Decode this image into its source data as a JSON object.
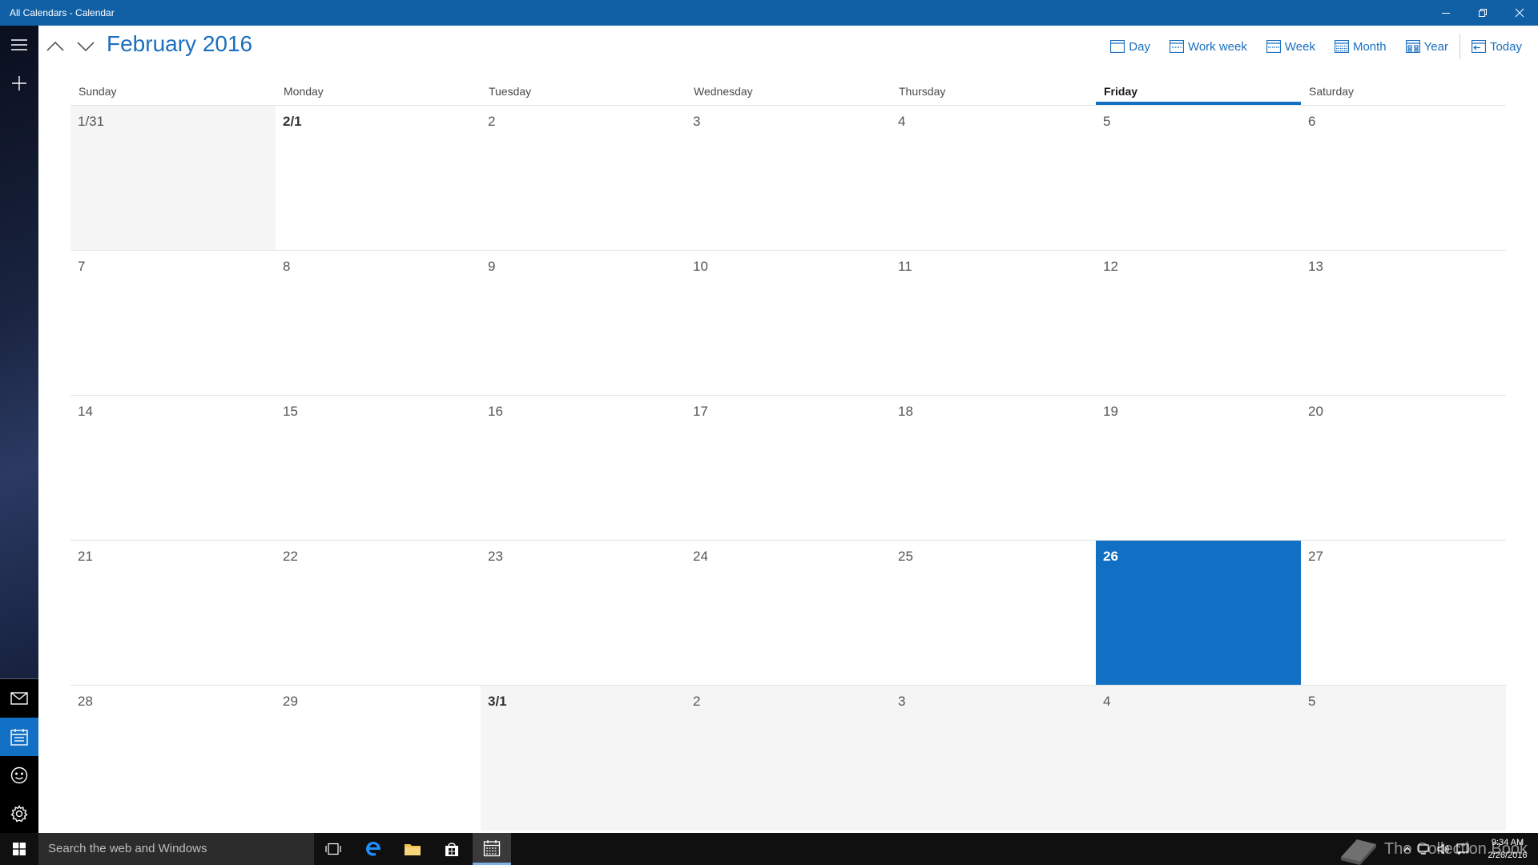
{
  "window": {
    "title": "All Calendars - Calendar"
  },
  "header": {
    "month_title": "February 2016",
    "views": [
      {
        "label": "Day",
        "icon": "day-view-icon"
      },
      {
        "label": "Work week",
        "icon": "work-week-view-icon"
      },
      {
        "label": "Week",
        "icon": "week-view-icon"
      },
      {
        "label": "Month",
        "icon": "month-view-icon"
      },
      {
        "label": "Year",
        "icon": "year-view-icon"
      },
      {
        "label": "Today",
        "icon": "today-icon"
      }
    ]
  },
  "calendar": {
    "weekdays": [
      "Sunday",
      "Monday",
      "Tuesday",
      "Wednesday",
      "Thursday",
      "Friday",
      "Saturday"
    ],
    "today_weekday_index": 5,
    "weeks": [
      [
        {
          "label": "1/31",
          "other": true
        },
        {
          "label": "2/1",
          "first": true
        },
        {
          "label": "2"
        },
        {
          "label": "3"
        },
        {
          "label": "4"
        },
        {
          "label": "5"
        },
        {
          "label": "6"
        }
      ],
      [
        {
          "label": "7"
        },
        {
          "label": "8"
        },
        {
          "label": "9"
        },
        {
          "label": "10"
        },
        {
          "label": "11"
        },
        {
          "label": "12"
        },
        {
          "label": "13"
        }
      ],
      [
        {
          "label": "14"
        },
        {
          "label": "15"
        },
        {
          "label": "16"
        },
        {
          "label": "17"
        },
        {
          "label": "18"
        },
        {
          "label": "19"
        },
        {
          "label": "20"
        }
      ],
      [
        {
          "label": "21"
        },
        {
          "label": "22"
        },
        {
          "label": "23"
        },
        {
          "label": "24"
        },
        {
          "label": "25"
        },
        {
          "label": "26",
          "today": true
        },
        {
          "label": "27"
        }
      ],
      [
        {
          "label": "28"
        },
        {
          "label": "29"
        },
        {
          "label": "3/1",
          "other": true,
          "first": true
        },
        {
          "label": "2",
          "other": true
        },
        {
          "label": "3",
          "other": true
        },
        {
          "label": "4",
          "other": true
        },
        {
          "label": "5",
          "other": true
        }
      ]
    ]
  },
  "taskbar": {
    "search_placeholder": "Search the web and Windows",
    "watermark": "The Collection Book",
    "time": "9:34 AM",
    "date": "2/26/2016"
  },
  "colors": {
    "accent": "#1170c4",
    "titlebar": "#1160a6",
    "title_text": "#1a6fc0"
  }
}
